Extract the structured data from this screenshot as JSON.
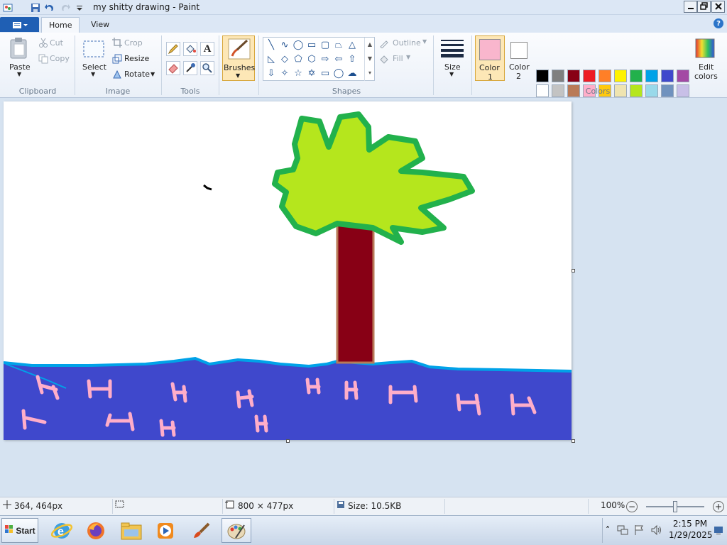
{
  "window": {
    "title": "my shitty drawing - Paint",
    "minimize_icon": "minimize-icon",
    "restore_icon": "restore-icon",
    "close_icon": "close-icon"
  },
  "quick_access": [
    "paint-app-icon",
    "save-icon",
    "undo-icon",
    "redo-icon",
    "customize-dropdown-icon"
  ],
  "tabs": [
    {
      "label": "Home",
      "active": true
    },
    {
      "label": "View",
      "active": false
    }
  ],
  "ribbon": {
    "clipboard": {
      "paste": "Paste",
      "cut": "Cut",
      "copy": "Copy",
      "group_label": "Clipboard"
    },
    "image": {
      "select": "Select",
      "crop": "Crop",
      "resize": "Resize",
      "rotate": "Rotate",
      "group_label": "Image"
    },
    "tools": {
      "group_label": "Tools",
      "items": [
        "pencil-icon",
        "fill-bucket-icon",
        "text-icon",
        "eraser-icon",
        "color-picker-icon",
        "magnifier-icon"
      ]
    },
    "brushes": {
      "label": "Brushes"
    },
    "shapes": {
      "outline": "Outline",
      "fill": "Fill",
      "group_label": "Shapes"
    },
    "size": {
      "label": "Size"
    },
    "colors": {
      "color1_label_line1": "Color",
      "color1_label_line2": "1",
      "color2_label_line1": "Color",
      "color2_label_line2": "2",
      "edit_colors_line1": "Edit",
      "edit_colors_line2": "colors",
      "group_label": "Colors",
      "color1": "#f9b6cd",
      "color2": "#ffffff",
      "palette_row1": [
        "#000000",
        "#7f7f7f",
        "#880015",
        "#ed1c24",
        "#ff7f27",
        "#fff200",
        "#22b14c",
        "#00a2e8",
        "#3f48cc",
        "#a349a4"
      ],
      "palette_row2": [
        "#ffffff",
        "#c3c3c3",
        "#b97a57",
        "#ffaec9",
        "#ffc90e",
        "#efe4b0",
        "#b5e61d",
        "#99d9ea",
        "#7092be",
        "#c8bfe7"
      ]
    }
  },
  "canvas": {
    "sky_color": "#ffffff",
    "water_color": "#3f48cc",
    "water_edge_color": "#00a2e8",
    "leaf_color": "#b5e61d",
    "leaf_outline": "#22b14c",
    "trunk_color": "#880015",
    "trunk_outline": "#b97a57",
    "fish_color": "#ffaec9"
  },
  "status": {
    "cursor_pos": "364, 464px",
    "selection_size": "",
    "canvas_size": "800 × 477px",
    "file_size": "Size: 10.5KB",
    "zoom": "100%",
    "zoom_percent": 100
  },
  "taskbar": {
    "start_label": "Start",
    "apps": [
      "internet-explorer-icon",
      "firefox-icon",
      "file-explorer-icon",
      "media-player-icon",
      "paintbrush-app-icon",
      "paint-app-icon"
    ],
    "time": "2:15 PM",
    "date": "1/29/2025"
  }
}
